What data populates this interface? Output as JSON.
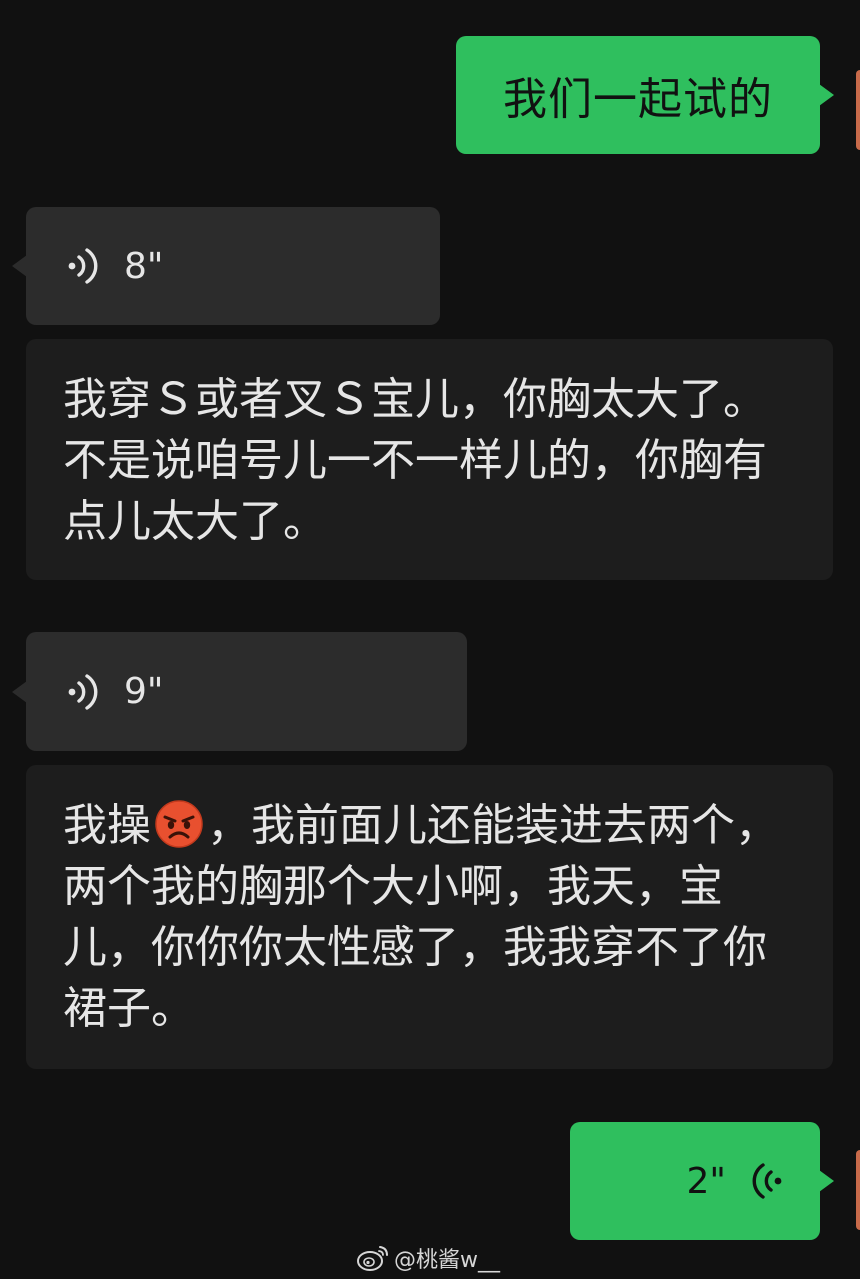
{
  "messages": {
    "sent_text": "我们一起试的",
    "voice_1": {
      "duration": "8\""
    },
    "transcript_1": "我穿Ｓ或者叉Ｓ宝儿，你胸太大了。不是说咱号儿一不一样儿的，你胸有点儿太大了。",
    "voice_2": {
      "duration": "9\""
    },
    "transcript_2": {
      "before_emoji": "我操",
      "emoji": "angry-face-emoji",
      "after_emoji": "，我前面儿还能装进去两个，两个我的胸那个大小啊，我天，宝儿，你你你太性感了，我我穿不了你裙子。"
    },
    "voice_3": {
      "duration": "2\""
    }
  },
  "watermark": {
    "icon": "weibo-icon",
    "text": "@桃酱w__"
  },
  "colors": {
    "background": "#111111",
    "sent_bubble": "#2fbf5e",
    "received_bubble": "#2c2c2c",
    "transcript_bg": "#1d1d1d"
  }
}
